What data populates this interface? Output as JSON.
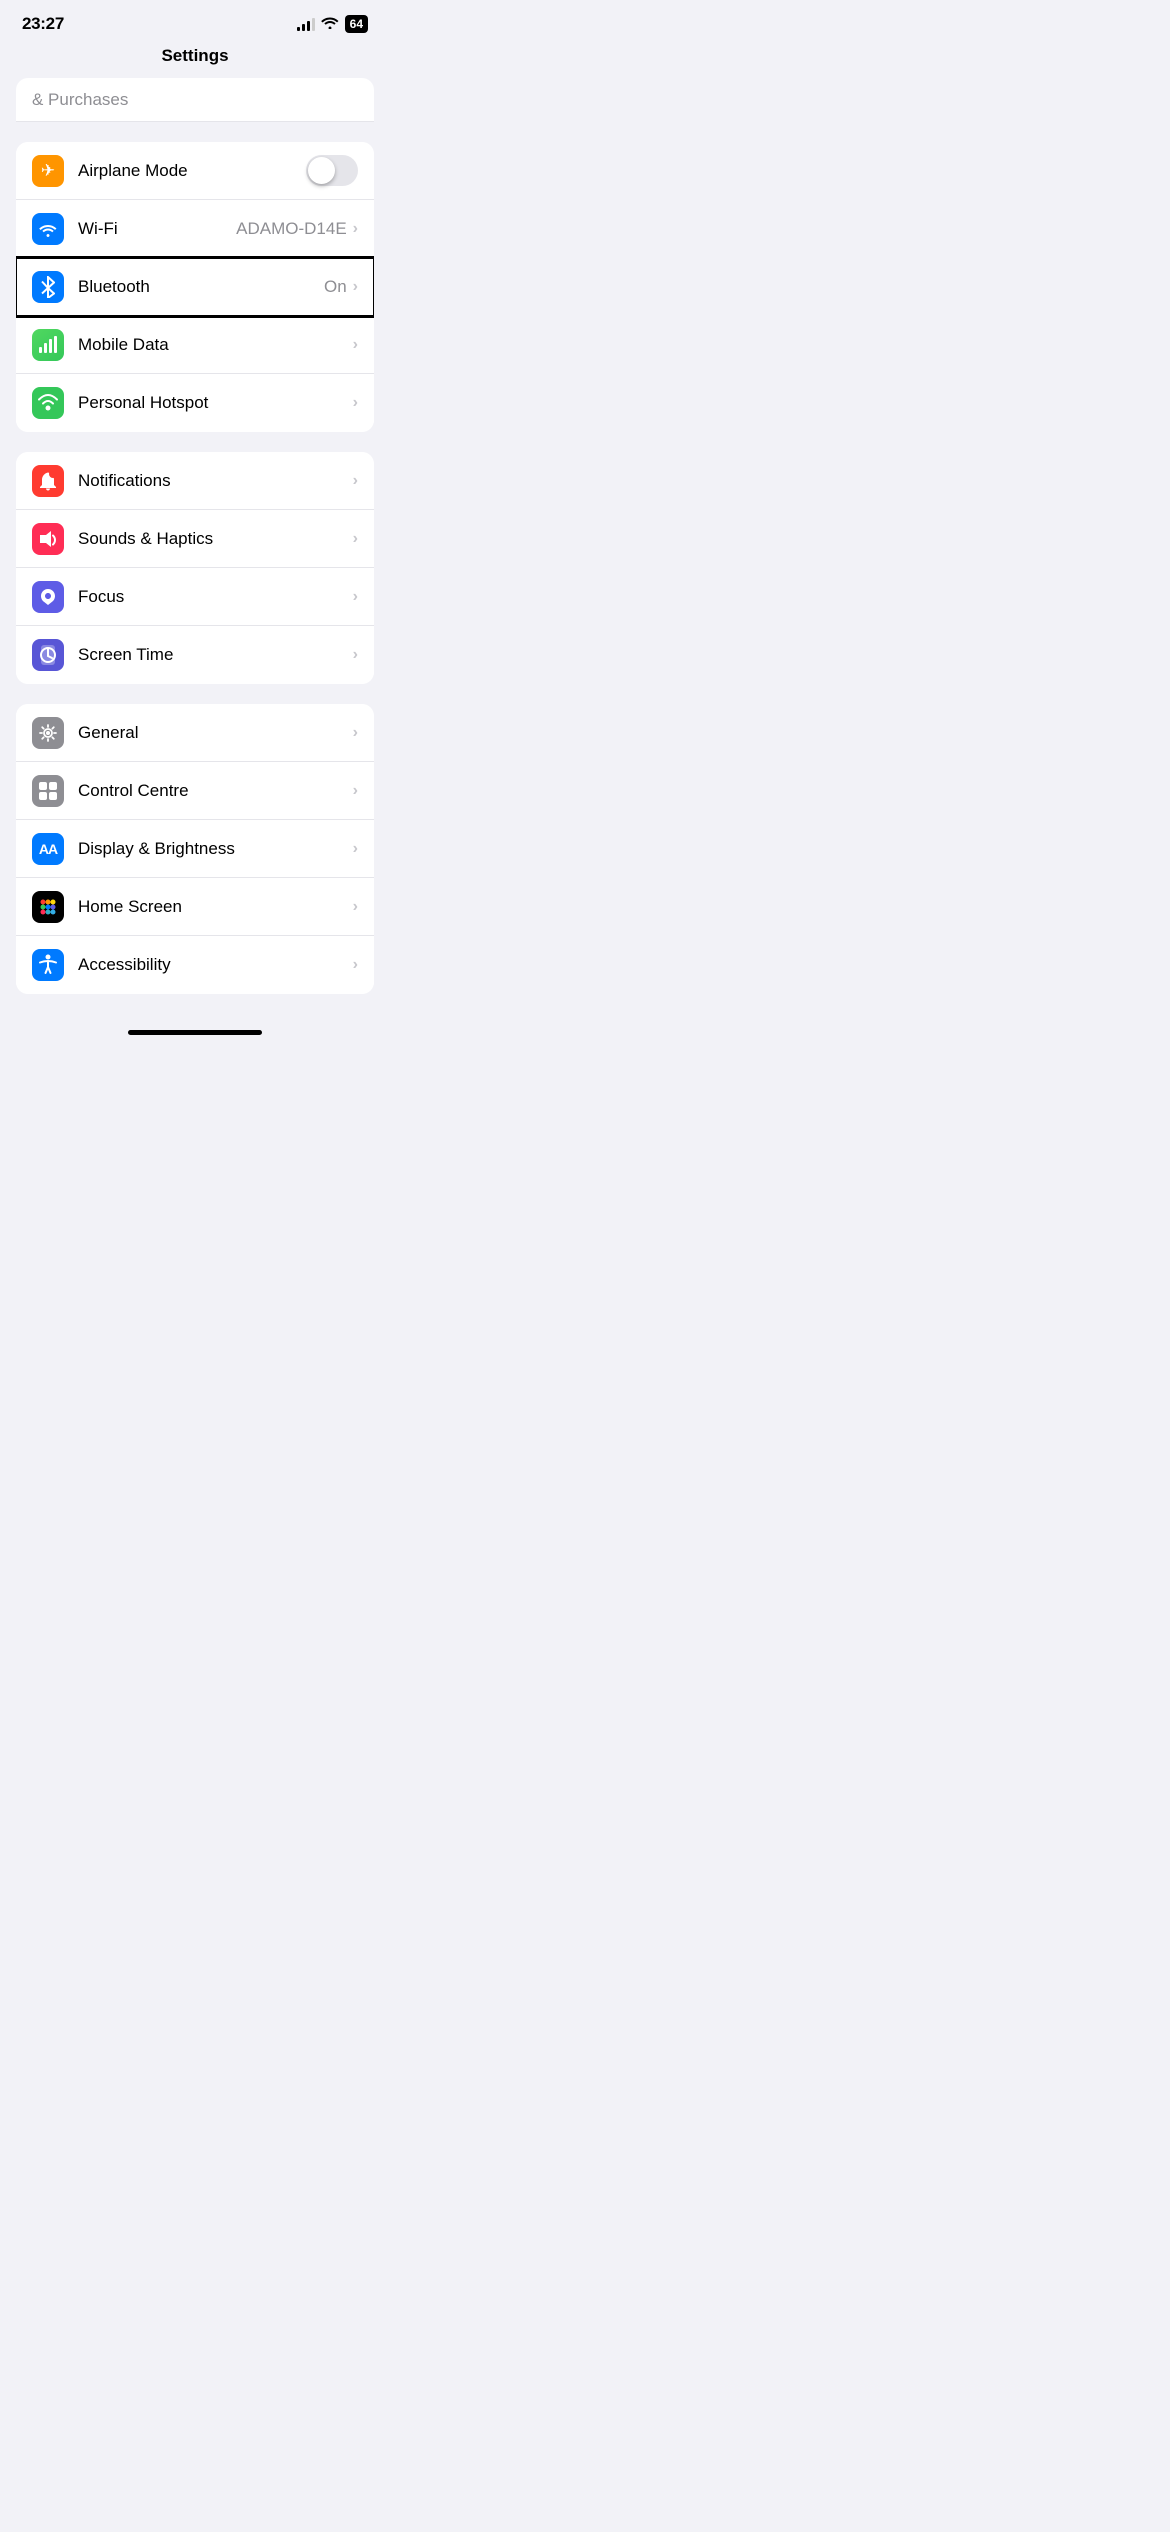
{
  "statusBar": {
    "time": "23:27",
    "battery": "64"
  },
  "navTitle": "Settings",
  "partialRow": {
    "label": "& Purchases"
  },
  "group1": {
    "rows": [
      {
        "id": "airplane-mode",
        "label": "Airplane Mode",
        "iconBg": "orange",
        "iconSymbol": "✈",
        "hasToggle": true,
        "toggleOn": false,
        "value": "",
        "hasChevron": false
      },
      {
        "id": "wifi",
        "label": "Wi-Fi",
        "iconBg": "blue",
        "iconSymbol": "wifi",
        "hasToggle": false,
        "value": "ADAMO-D14E",
        "hasChevron": true
      },
      {
        "id": "bluetooth",
        "label": "Bluetooth",
        "iconBg": "blue",
        "iconSymbol": "bluetooth",
        "hasToggle": false,
        "value": "On",
        "hasChevron": true,
        "highlighted": true
      },
      {
        "id": "mobile-data",
        "label": "Mobile Data",
        "iconBg": "green-data",
        "iconSymbol": "signal",
        "hasToggle": false,
        "value": "",
        "hasChevron": true
      },
      {
        "id": "personal-hotspot",
        "label": "Personal Hotspot",
        "iconBg": "green-hot",
        "iconSymbol": "link",
        "hasToggle": false,
        "value": "",
        "hasChevron": true
      }
    ]
  },
  "group2": {
    "rows": [
      {
        "id": "notifications",
        "label": "Notifications",
        "iconBg": "red-notif",
        "iconSymbol": "bell",
        "value": "",
        "hasChevron": true
      },
      {
        "id": "sounds-haptics",
        "label": "Sounds & Haptics",
        "iconBg": "pink-sound",
        "iconSymbol": "speaker",
        "value": "",
        "hasChevron": true
      },
      {
        "id": "focus",
        "label": "Focus",
        "iconBg": "purple-focus",
        "iconSymbol": "moon",
        "value": "",
        "hasChevron": true
      },
      {
        "id": "screen-time",
        "label": "Screen Time",
        "iconBg": "purple-screen",
        "iconSymbol": "hourglass",
        "value": "",
        "hasChevron": true
      }
    ]
  },
  "group3": {
    "rows": [
      {
        "id": "general",
        "label": "General",
        "iconBg": "gray-general",
        "iconSymbol": "gear",
        "value": "",
        "hasChevron": true
      },
      {
        "id": "control-centre",
        "label": "Control Centre",
        "iconBg": "gray-control",
        "iconSymbol": "sliders",
        "value": "",
        "hasChevron": true
      },
      {
        "id": "display-brightness",
        "label": "Display & Brightness",
        "iconBg": "blue-display",
        "iconSymbol": "AA",
        "value": "",
        "hasChevron": true
      },
      {
        "id": "home-screen",
        "label": "Home Screen",
        "iconBg": "black-home",
        "iconSymbol": "grid",
        "value": "",
        "hasChevron": true
      },
      {
        "id": "accessibility",
        "label": "Accessibility",
        "iconBg": "blue-access",
        "iconSymbol": "person",
        "value": "",
        "hasChevron": true
      }
    ]
  }
}
